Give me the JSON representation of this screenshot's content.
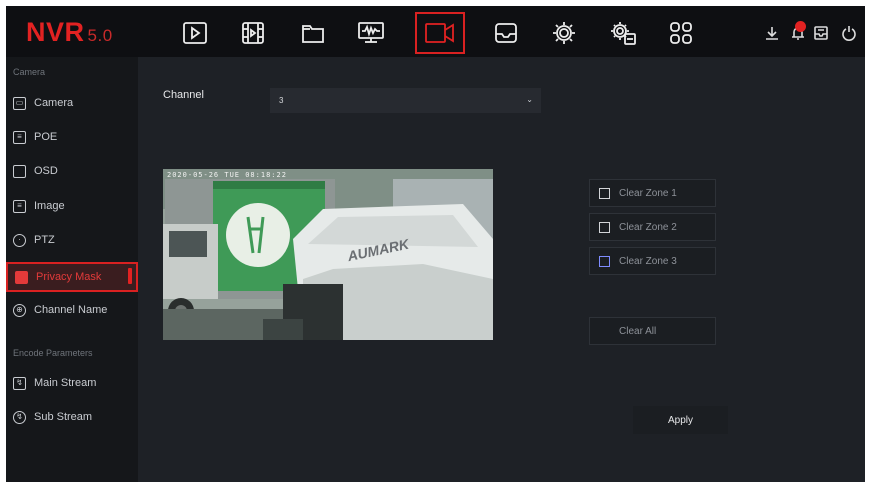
{
  "app": {
    "logo": "NVR",
    "version": "5.0"
  },
  "topnav": [
    {
      "name": "playback-icon"
    },
    {
      "name": "video-clips-icon"
    },
    {
      "name": "files-icon"
    },
    {
      "name": "monitor-icon"
    },
    {
      "name": "camera-icon",
      "active": true
    },
    {
      "name": "storage-icon"
    },
    {
      "name": "settings-icon"
    },
    {
      "name": "system-settings-icon"
    },
    {
      "name": "apps-grid-icon"
    }
  ],
  "system_icons": [
    "download-icon",
    "alarm-icon",
    "messages-icon",
    "power-icon"
  ],
  "sidebar": {
    "section_camera": "Camera",
    "items": [
      {
        "label": "Camera"
      },
      {
        "label": "POE"
      },
      {
        "label": "OSD"
      },
      {
        "label": "Image"
      },
      {
        "label": "PTZ"
      },
      {
        "label": "Privacy Mask",
        "active": true
      },
      {
        "label": "Channel Name"
      }
    ],
    "section_encode": "Encode Parameters",
    "encode_items": [
      {
        "label": "Main Stream"
      },
      {
        "label": "Sub Stream"
      }
    ]
  },
  "main": {
    "channel_label": "Channel",
    "channel_value": "3",
    "video_osd": "2020-05-26 TUE 08:18:22",
    "zones": [
      "Clear Zone 1",
      "Clear Zone 2",
      "Clear Zone 3"
    ],
    "clear_all": "Clear All",
    "apply": "Apply"
  },
  "colors": {
    "accent": "#e22222",
    "background": "#1e2126",
    "sidebar": "#15171a",
    "topbar": "#0e0f12"
  }
}
